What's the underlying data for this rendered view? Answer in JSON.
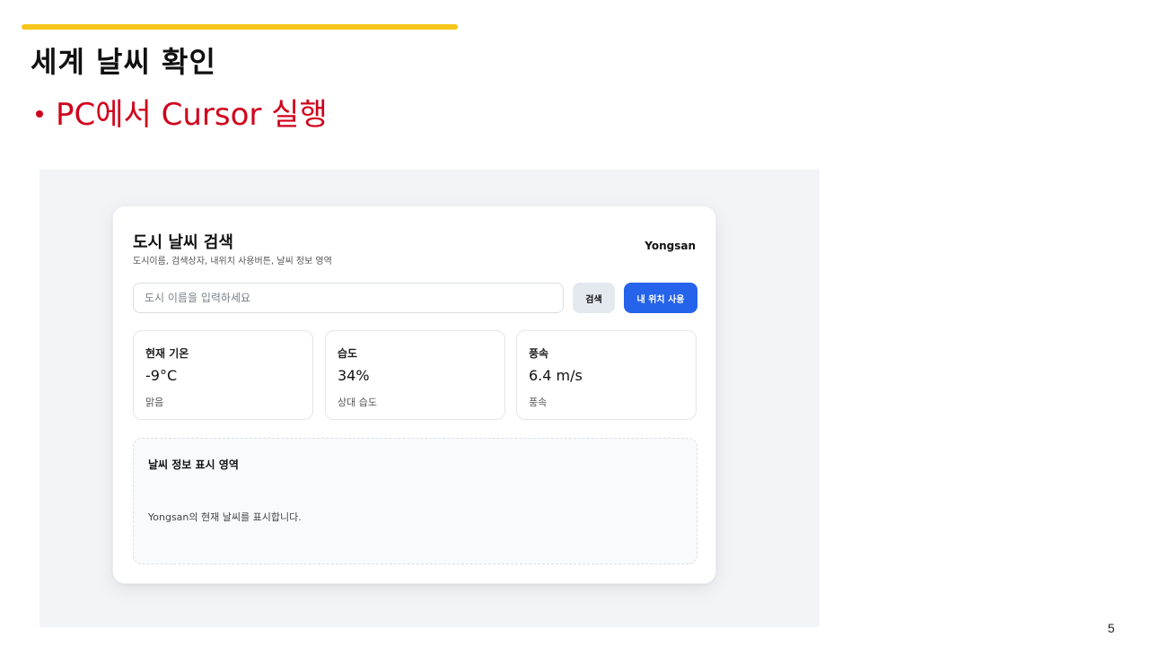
{
  "slide": {
    "title": "세계 날씨 확인",
    "bullet": "PC에서 Cursor 실행",
    "page_number": "5",
    "accent_color": "#f5c518",
    "bullet_color": "#d0021b"
  },
  "app": {
    "header": {
      "title": "도시 날씨 검색",
      "subtitle": "도시이름, 검색상자, 내위치 사용버튼, 날씨 정보 영역",
      "location": "Yongsan"
    },
    "search": {
      "placeholder": "도시 이름을 입력하세요",
      "value": "",
      "search_label": "검색",
      "location_label": "내 위치 사용"
    },
    "stats": [
      {
        "label": "현재 기온",
        "value": "-9°C",
        "desc": "맑음"
      },
      {
        "label": "습도",
        "value": "34%",
        "desc": "상대 습도"
      },
      {
        "label": "풍속",
        "value": "6.4 m/s",
        "desc": "풍속"
      }
    ],
    "info": {
      "title": "날씨 정보 표시 영역",
      "text": "Yongsan의 현재 날씨를 표시합니다."
    },
    "colors": {
      "primary_button": "#2563eb",
      "secondary_button": "#e4e8ef",
      "frame_background": "#f3f4f7"
    }
  }
}
